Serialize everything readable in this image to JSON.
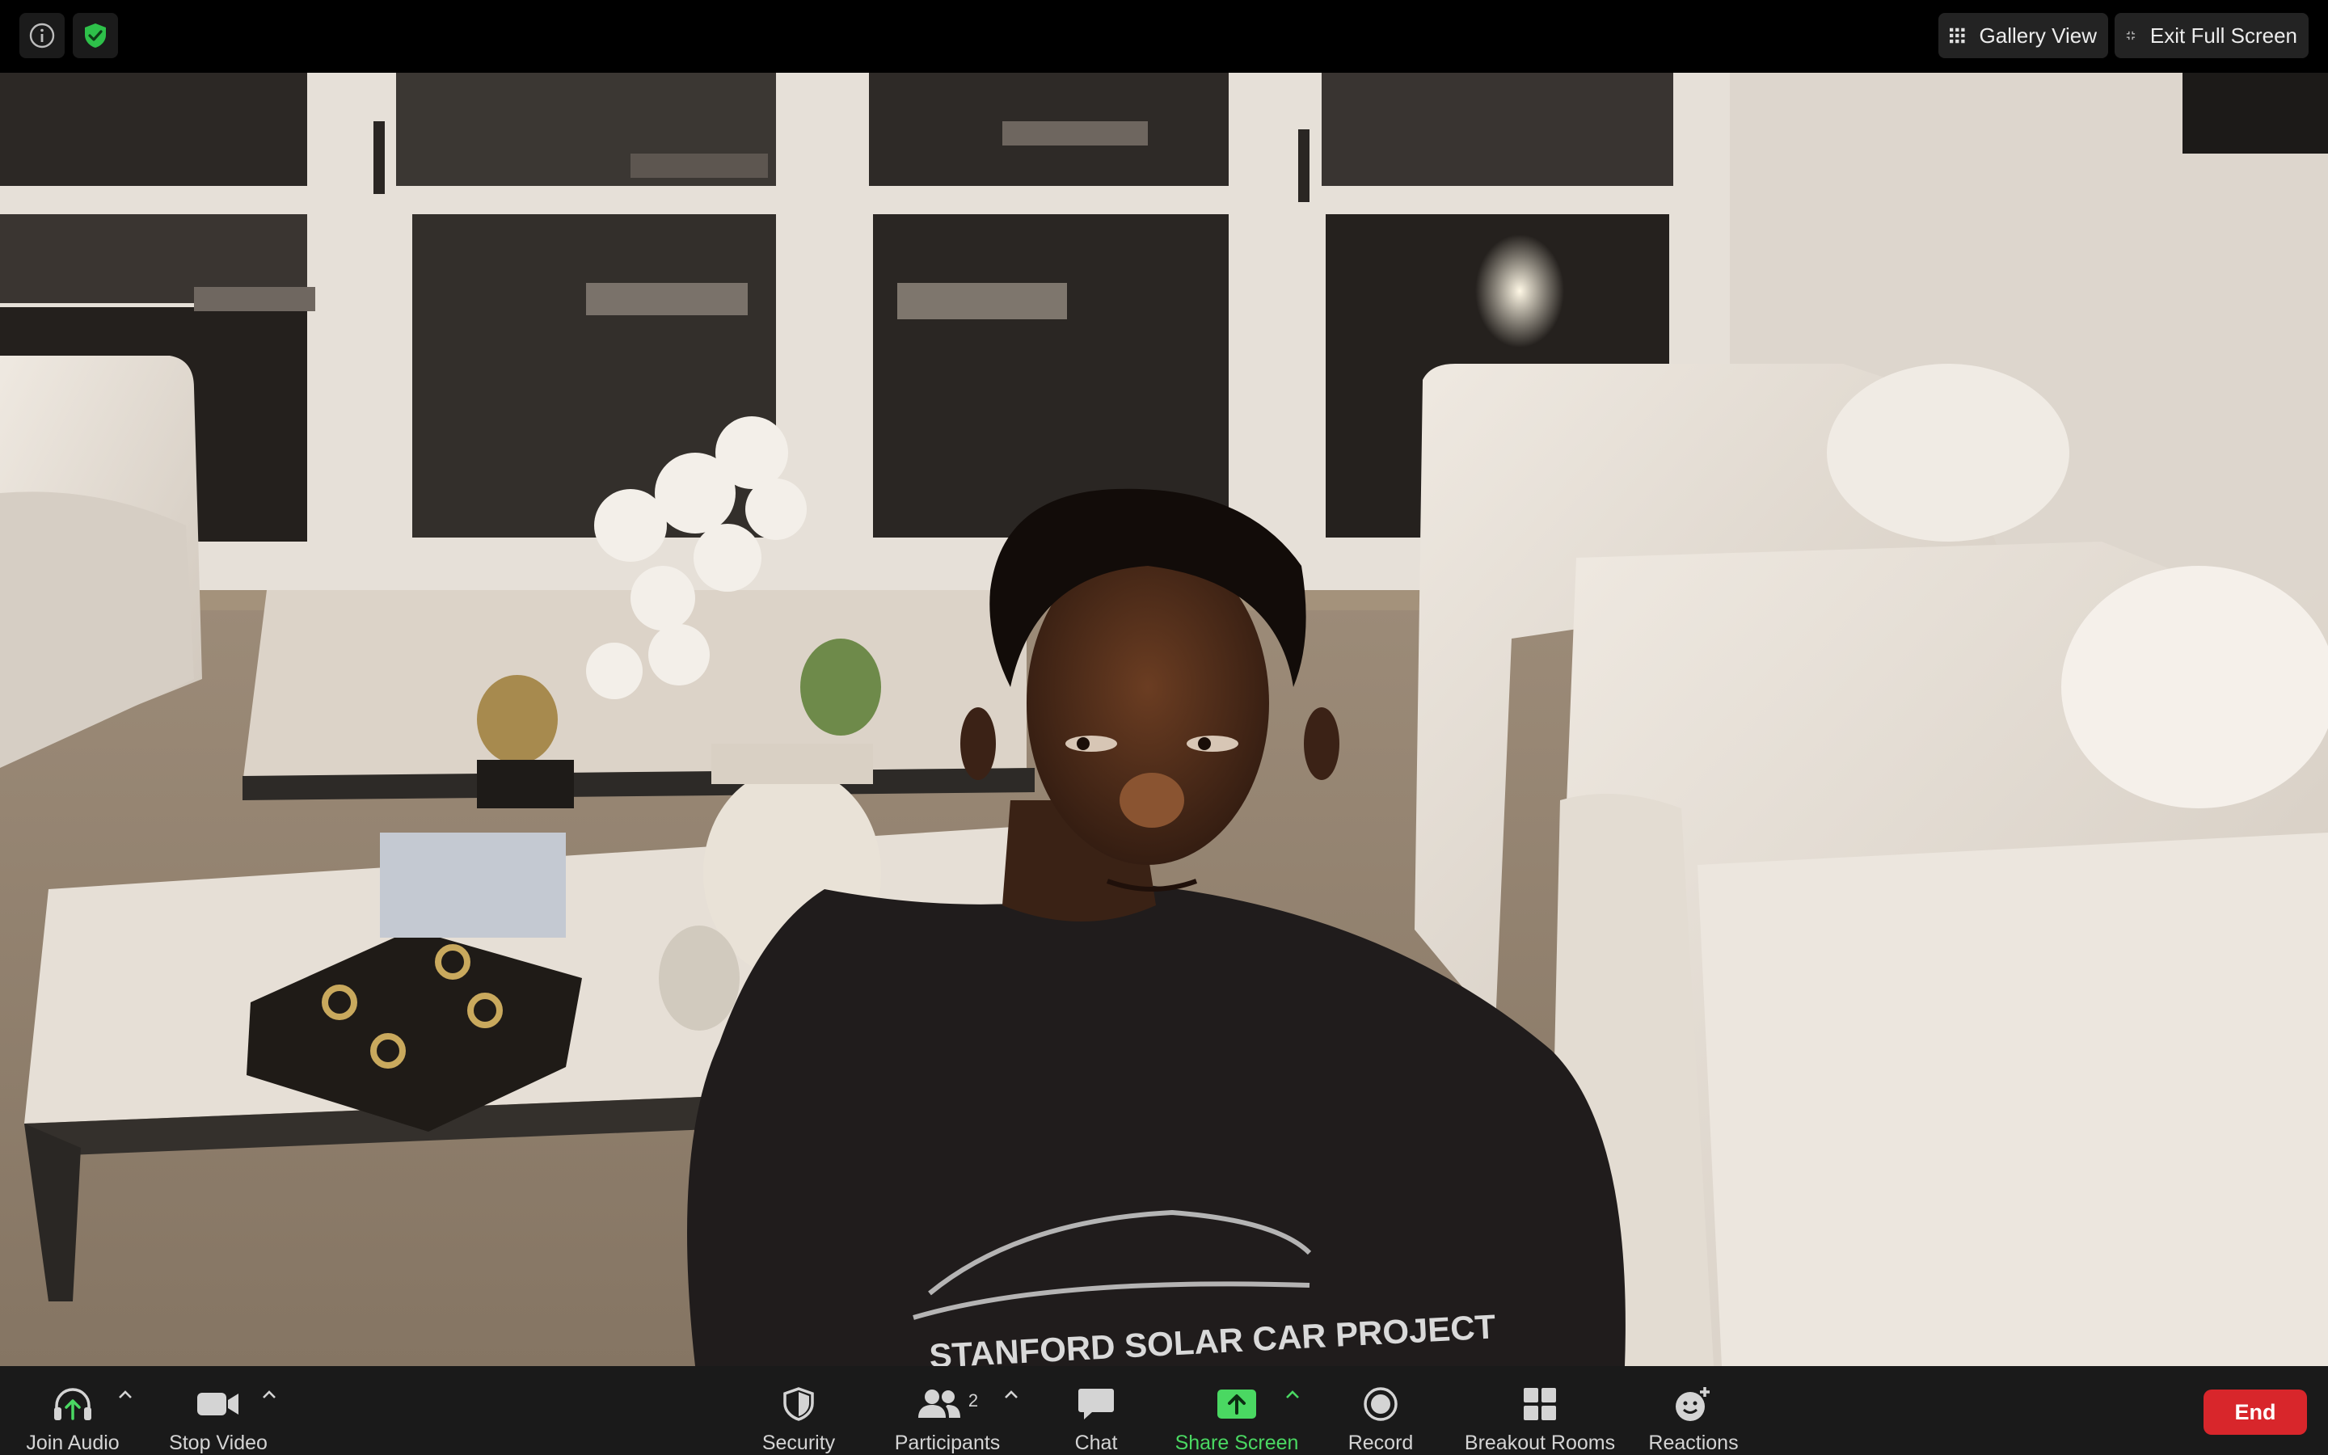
{
  "top_bar": {
    "info_icon": "info-icon",
    "security_icon": "shield-check-icon",
    "gallery_view_label": "Gallery View",
    "exit_full_screen_label": "Exit Full Screen"
  },
  "toolbar": {
    "join_audio": {
      "label": "Join Audio",
      "icon": "headphones-arrow-icon"
    },
    "stop_video": {
      "label": "Stop Video",
      "icon": "video-camera-icon"
    },
    "security": {
      "label": "Security",
      "icon": "shield-icon"
    },
    "participants": {
      "label": "Participants",
      "icon": "people-icon",
      "count": "2"
    },
    "chat": {
      "label": "Chat",
      "icon": "chat-bubble-icon"
    },
    "share_screen": {
      "label": "Share Screen",
      "icon": "share-arrow-icon"
    },
    "record": {
      "label": "Record",
      "icon": "record-icon"
    },
    "breakout_rooms": {
      "label": "Breakout Rooms",
      "icon": "grid-icon"
    },
    "reactions": {
      "label": "Reactions",
      "icon": "smiley-plus-icon"
    },
    "end": {
      "label": "End"
    }
  },
  "colors": {
    "end_button": "#d8262b",
    "share_screen_accent": "#4ad862",
    "security_badge": "#2ec04a",
    "toolbar_bg": "#1a1a1a"
  }
}
